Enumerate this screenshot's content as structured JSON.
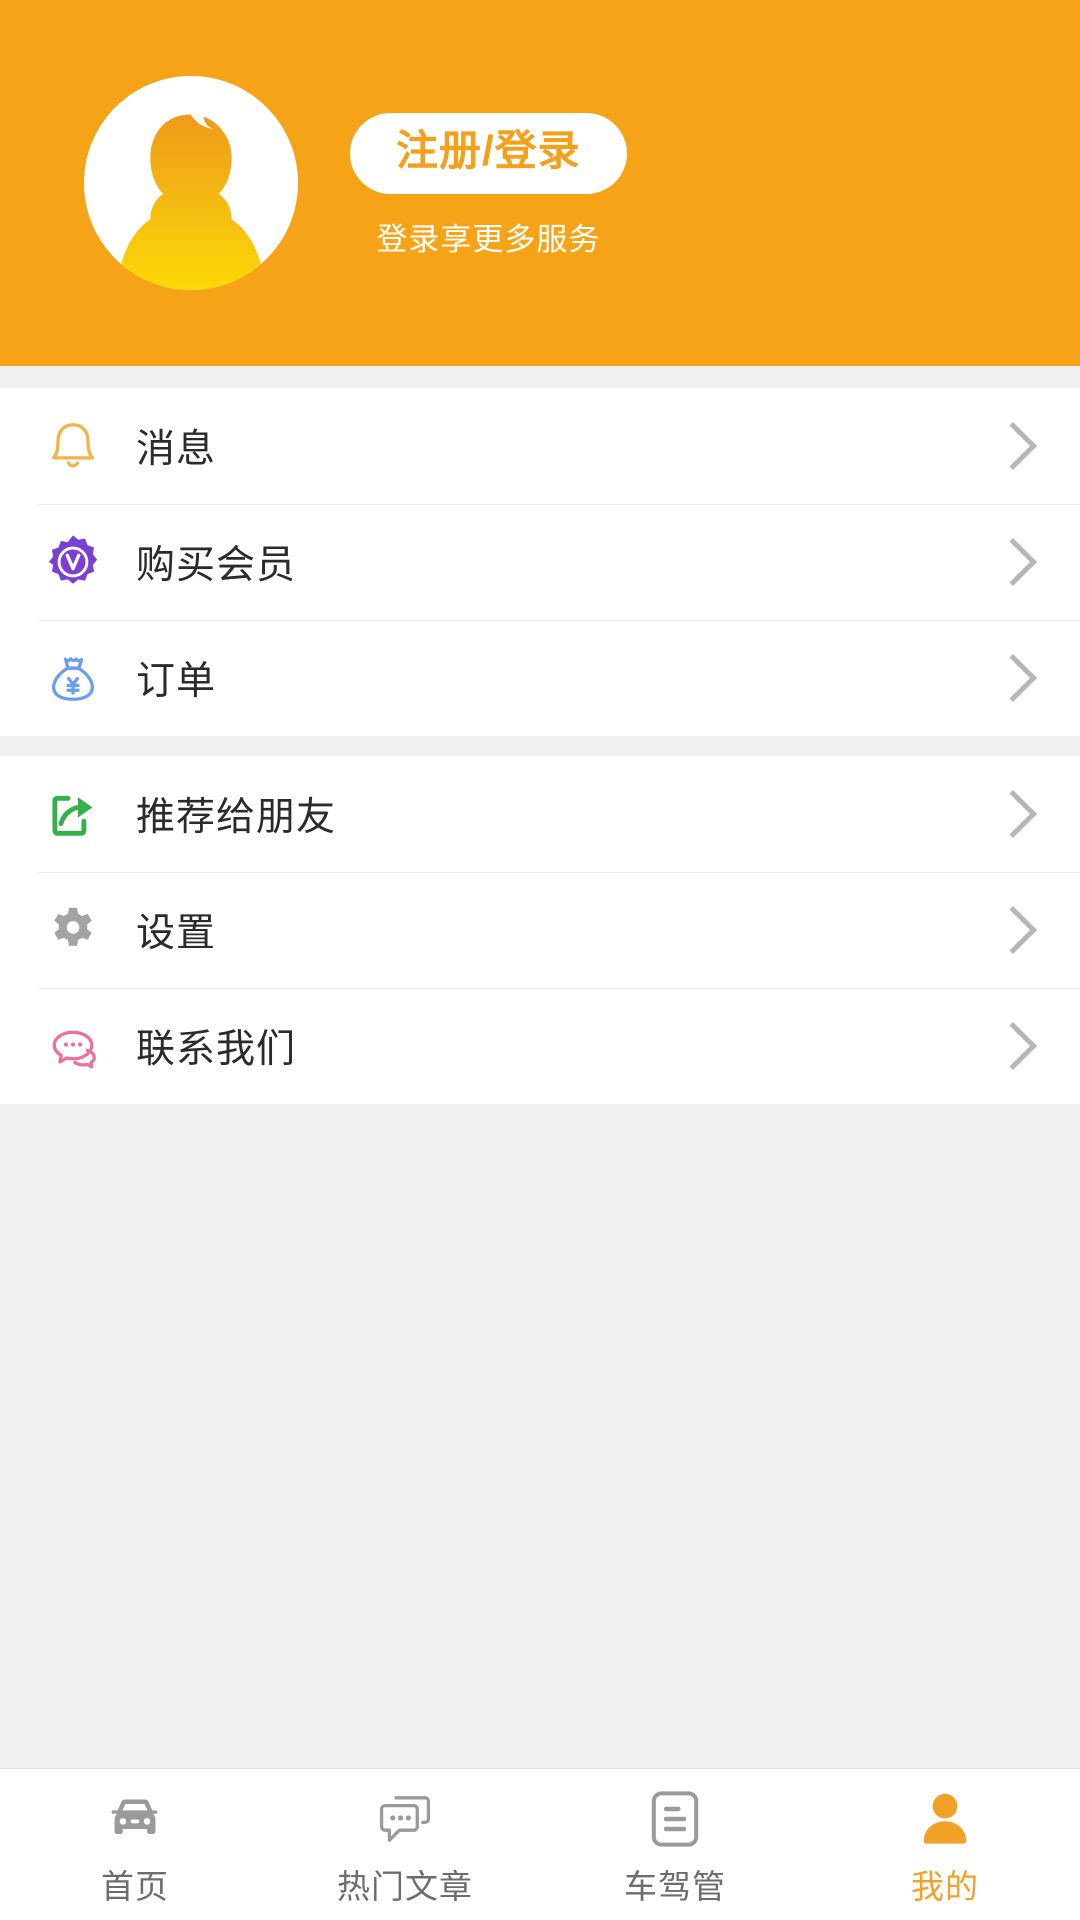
{
  "header": {
    "background_color": "#f7a317",
    "avatar_icon": "user-avatar-placeholder-icon",
    "login_button_label": "注册/登录",
    "login_subtitle": "登录享更多服务",
    "login_button_text_color": "#f4a01b"
  },
  "menu_groups": [
    {
      "items": [
        {
          "icon": "bell-icon",
          "icon_color": "#f3b24a",
          "label": "消息",
          "chevron": "chevron-right-icon"
        },
        {
          "icon": "vip-badge-icon",
          "icon_color": "#7b3fd4",
          "label": "购买会员",
          "chevron": "chevron-right-icon"
        },
        {
          "icon": "money-bag-icon",
          "icon_color": "#6a9ef0",
          "label": "订单",
          "chevron": "chevron-right-icon"
        }
      ]
    },
    {
      "items": [
        {
          "icon": "share-icon",
          "icon_color": "#35b14a",
          "label": "推荐给朋友",
          "chevron": "chevron-right-icon"
        },
        {
          "icon": "gear-icon",
          "icon_color": "#a3a3a3",
          "label": "设置",
          "chevron": "chevron-right-icon"
        },
        {
          "icon": "chat-bubbles-icon",
          "icon_color": "#ee6f9e",
          "label": "联系我们",
          "chevron": "chevron-right-icon"
        }
      ]
    }
  ],
  "tabbar": {
    "active_color": "#f2a128",
    "inactive_color": "#6d6d6d",
    "tabs": [
      {
        "icon": "car-icon",
        "label": "首页",
        "active": false
      },
      {
        "icon": "chat-bubbles-icon",
        "label": "热门文章",
        "active": false
      },
      {
        "icon": "document-icon",
        "label": "车驾管",
        "active": false
      },
      {
        "icon": "person-icon",
        "label": "我的",
        "active": true
      }
    ]
  }
}
